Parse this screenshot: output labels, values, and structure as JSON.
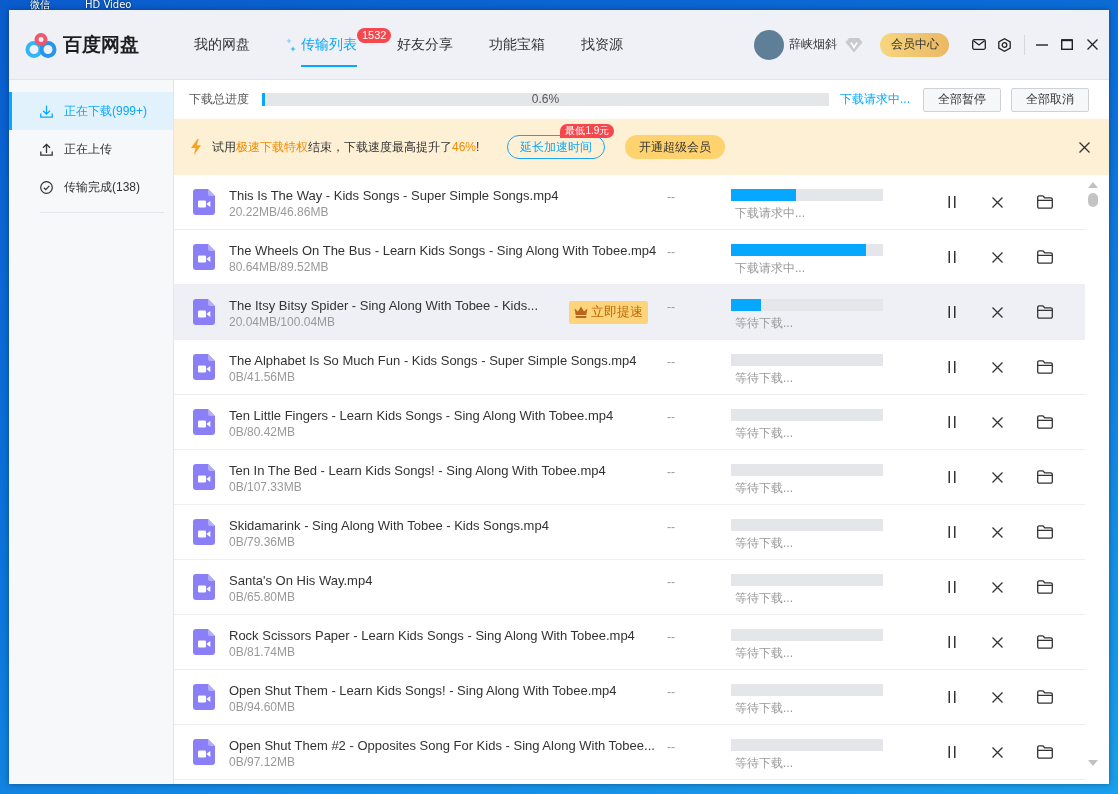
{
  "desktop": {
    "labels": [
      "微信",
      "HD Video"
    ]
  },
  "header": {
    "app_name": "百度网盘",
    "tabs": [
      {
        "label": "我的网盘",
        "kind": "plain",
        "selected": false
      },
      {
        "label": "传输列表",
        "kind": "transfer",
        "selected": true,
        "badge": "1532"
      },
      {
        "label": "好友分享",
        "kind": "plain",
        "selected": false
      },
      {
        "label": "功能宝箱",
        "kind": "plain",
        "selected": false
      },
      {
        "label": "找资源",
        "kind": "plain",
        "selected": false
      }
    ],
    "user_name": "辞峡烟斜",
    "member_center_button": "会员中心"
  },
  "sidebar": {
    "items": [
      {
        "label": "正在下载(999+)",
        "kind": "download",
        "selected": true
      },
      {
        "label": "正在上传",
        "kind": "upload",
        "selected": false
      },
      {
        "label": "传输完成(138)",
        "kind": "complete",
        "selected": false
      }
    ]
  },
  "total_progress": {
    "label": "下载总进度",
    "level": 0.006,
    "reading": "0.6%",
    "status": "下载请求中...",
    "buttons": [
      "全部暂停",
      "全部取消"
    ]
  },
  "promo_banner": {
    "message": "试用**极速下载特权**结束，下载速度最高提升了**46%**!",
    "extend_button": "延长加速时间",
    "price_badge": "最低1.9元",
    "upgrade_button": "开通超级会员"
  },
  "downloads": [
    {
      "name": "This Is The Way - Kids Songs - Super Simple Songs.mp4",
      "size": "20.22MB/46.86MB",
      "speed": "--",
      "level": 0.43,
      "status": "下载请求中...",
      "highlighted": false
    },
    {
      "name": "The Wheels On The Bus - Learn Kids Songs - Sing Along With Tobee.mp4",
      "size": "80.64MB/89.52MB",
      "speed": "--",
      "level": 0.89,
      "status": "下载请求中...",
      "highlighted": false
    },
    {
      "name": "The Itsy Bitsy Spider - Sing Along With Tobee - Kids...",
      "size": "20.04MB/100.04MB",
      "speed": "--",
      "level": 0.2,
      "status": "等待下载...",
      "highlighted": true,
      "boost_button": "立即提速"
    },
    {
      "name": "The Alphabet Is So Much Fun - Kids Songs - Super Simple Songs.mp4",
      "size": "0B/41.56MB",
      "speed": "--",
      "level": 0,
      "status": "等待下载...",
      "highlighted": false
    },
    {
      "name": "Ten Little Fingers - Learn Kids Songs - Sing Along With Tobee.mp4",
      "size": "0B/80.42MB",
      "speed": "--",
      "level": 0,
      "status": "等待下载...",
      "highlighted": false
    },
    {
      "name": "Ten In The Bed - Learn Kids Songs! - Sing Along With Tobee.mp4",
      "size": "0B/107.33MB",
      "speed": "--",
      "level": 0,
      "status": "等待下载...",
      "highlighted": false
    },
    {
      "name": "Skidamarink - Sing Along With Tobee - Kids Songs.mp4",
      "size": "0B/79.36MB",
      "speed": "--",
      "level": 0,
      "status": "等待下载...",
      "highlighted": false
    },
    {
      "name": "Santa's On His Way.mp4",
      "size": "0B/65.80MB",
      "speed": "--",
      "level": 0,
      "status": "等待下载...",
      "highlighted": false
    },
    {
      "name": "Rock Scissors Paper - Learn Kids Songs - Sing Along With Tobee.mp4",
      "size": "0B/81.74MB",
      "speed": "--",
      "level": 0,
      "status": "等待下载...",
      "highlighted": false
    },
    {
      "name": "Open Shut Them - Learn Kids Songs! - Sing Along With Tobee.mp4",
      "size": "0B/94.60MB",
      "speed": "--",
      "level": 0,
      "status": "等待下载...",
      "highlighted": false
    },
    {
      "name": "Open Shut Them #2 - Opposites Song For Kids - Sing Along With Tobee...",
      "size": "0B/97.12MB",
      "speed": "--",
      "level": 0,
      "status": "等待下载...",
      "highlighted": false
    }
  ]
}
